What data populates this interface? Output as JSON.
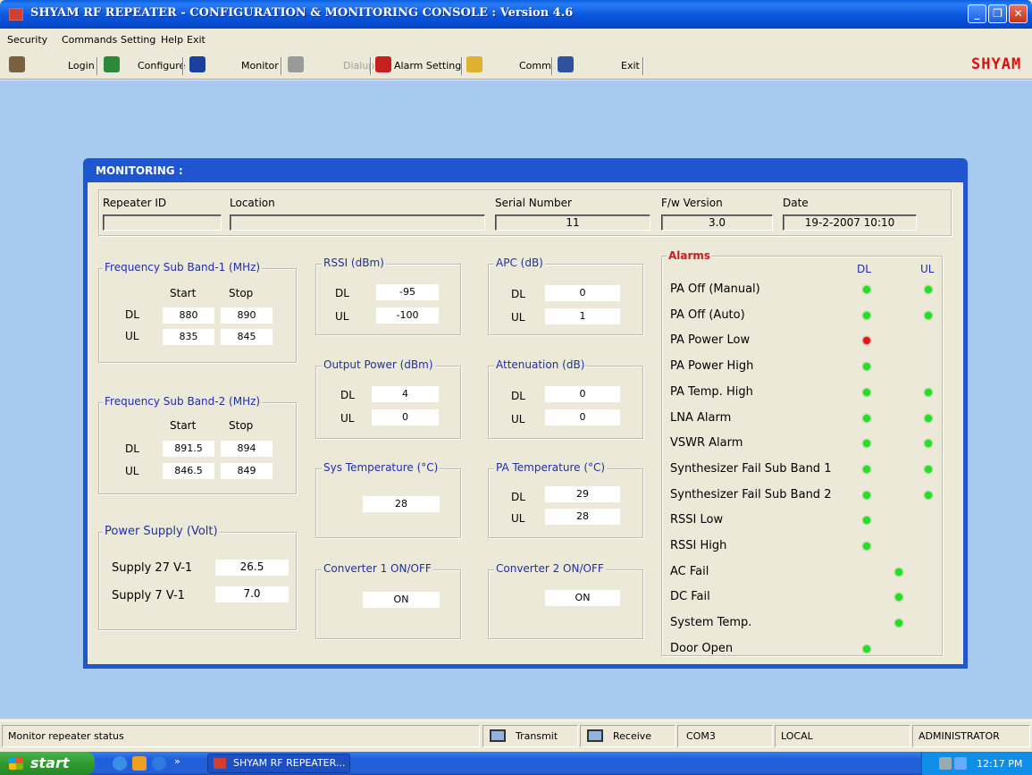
{
  "window": {
    "title": "SHYAM RF REPEATER - CONFIGURATION & MONITORING CONSOLE  :  Version 4.6",
    "min_label": "_",
    "max_label": "❐",
    "close_label": "✕"
  },
  "menu": [
    "Security",
    "Commands",
    "Setting",
    "Help",
    "Exit"
  ],
  "toolbar": {
    "login": "Login",
    "configure": "Configure",
    "monitor": "Monitor",
    "dialup": "Dialup",
    "alarm_setting": "Alarm Setting",
    "comm": "Comm.",
    "exit": "Exit",
    "brand": "SHYAM"
  },
  "monitoring": {
    "title": "MONITORING :",
    "header": {
      "repeater_id_label": "Repeater ID",
      "repeater_id": "",
      "location_label": "Location",
      "location": "",
      "serial_label": "Serial Number",
      "serial": "11",
      "fw_label": "F/w Version",
      "fw": "3.0",
      "date_label": "Date",
      "date": "19-2-2007 10:10"
    },
    "band1": {
      "title": "Frequency Sub Band-1 (MHz)",
      "start_label": "Start",
      "stop_label": "Stop",
      "dl_label": "DL",
      "ul_label": "UL",
      "dl_start": "880",
      "dl_stop": "890",
      "ul_start": "835",
      "ul_stop": "845"
    },
    "band2": {
      "title": "Frequency Sub Band-2 (MHz)",
      "start_label": "Start",
      "stop_label": "Stop",
      "dl_label": "DL",
      "ul_label": "UL",
      "dl_start": "891.5",
      "dl_stop": "894",
      "ul_start": "846.5",
      "ul_stop": "849"
    },
    "power_supply": {
      "title": "Power Supply (Volt)",
      "s1_label": "Supply 27 V-1",
      "s1": "26.5",
      "s2_label": "Supply 7 V-1",
      "s2": "7.0"
    },
    "rssi": {
      "title": "RSSI (dBm)",
      "dl_label": "DL",
      "ul_label": "UL",
      "dl": "-95",
      "ul": "-100"
    },
    "apc": {
      "title": "APC (dB)",
      "dl_label": "DL",
      "ul_label": "UL",
      "dl": "0",
      "ul": "1"
    },
    "output_power": {
      "title": "Output Power (dBm)",
      "dl_label": "DL",
      "ul_label": "UL",
      "dl": "4",
      "ul": "0"
    },
    "attenuation": {
      "title": "Attenuation (dB)",
      "dl_label": "DL",
      "ul_label": "UL",
      "dl": "0",
      "ul": "0"
    },
    "sys_temp": {
      "title": "Sys Temperature (°C)",
      "value": "28"
    },
    "pa_temp": {
      "title": "PA Temperature (°C)",
      "dl_label": "DL",
      "ul_label": "UL",
      "dl": "29",
      "ul": "28"
    },
    "conv1": {
      "title": "Converter 1 ON/OFF",
      "value": "ON"
    },
    "conv2": {
      "title": "Converter 2 ON/OFF",
      "value": "ON"
    },
    "alarms": {
      "title": "Alarms",
      "dl_label": "DL",
      "ul_label": "UL",
      "rows": [
        {
          "label": "PA Off (Manual)",
          "dl": "green",
          "ul": "green"
        },
        {
          "label": "PA Off (Auto)",
          "dl": "green",
          "ul": "green"
        },
        {
          "label": "PA Power Low",
          "dl": "red",
          "ul": ""
        },
        {
          "label": "PA Power High",
          "dl": "green",
          "ul": ""
        },
        {
          "label": "PA Temp. High",
          "dl": "green",
          "ul": "green"
        },
        {
          "label": "LNA Alarm",
          "dl": "green",
          "ul": "green"
        },
        {
          "label": "VSWR Alarm",
          "dl": "green",
          "ul": "green"
        },
        {
          "label": "Synthesizer Fail Sub Band 1",
          "dl": "green",
          "ul": "green"
        },
        {
          "label": "Synthesizer Fail Sub Band 2",
          "dl": "green",
          "ul": "green"
        },
        {
          "label": "RSSI Low",
          "dl": "green",
          "ul": ""
        },
        {
          "label": "RSSI High",
          "dl": "green",
          "ul": ""
        },
        {
          "label": "AC Fail",
          "mid": "green"
        },
        {
          "label": "DC Fail",
          "mid": "green"
        },
        {
          "label": "System Temp.",
          "mid": "green"
        },
        {
          "label": "Door Open",
          "dl": "green",
          "ul": ""
        }
      ]
    }
  },
  "status": {
    "message": "Monitor repeater status",
    "transmit": "Transmit",
    "receive": "Receive",
    "port": "COM3",
    "mode": "LOCAL",
    "user": "ADMINISTRATOR"
  },
  "taskbar": {
    "start": "start",
    "app": "SHYAM RF REPEATER...",
    "clock": "12:17 PM",
    "chevron": "»"
  },
  "colors": {
    "led_green": "#22e022",
    "led_red": "#ee1111",
    "legend_text": "#1f2fa8",
    "alarm_title": "#c81e1e"
  }
}
